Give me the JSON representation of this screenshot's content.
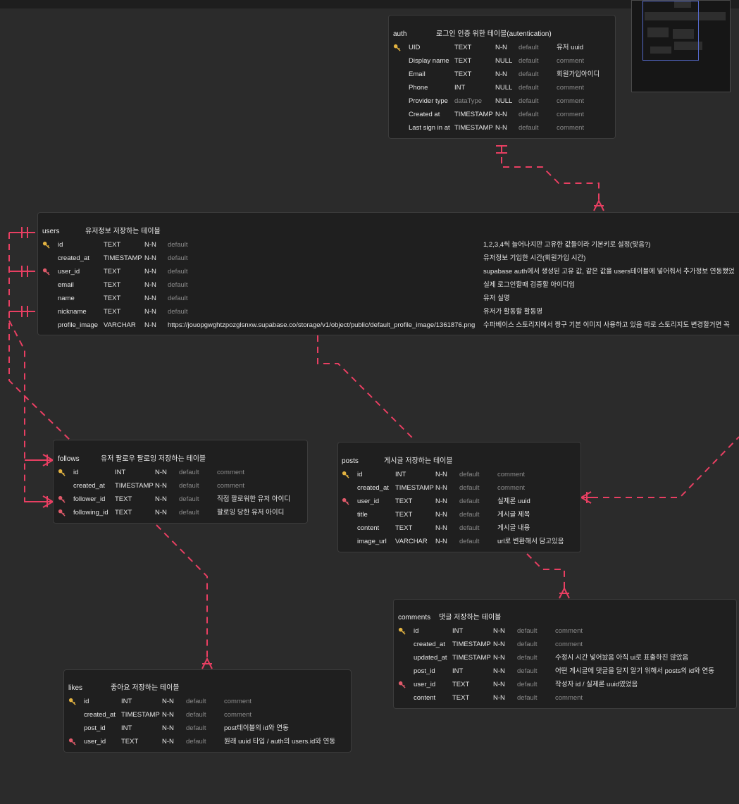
{
  "colors": {
    "relation": "#e83f62",
    "key_gold": "#e3b341",
    "key_red": "#e05a6a",
    "canvas": "#2b2b2b",
    "table_bg": "#1f1f1f"
  },
  "tables": {
    "auth": {
      "name": "auth",
      "description": "로그인 인증 위한 테이블(autentication)",
      "rows": [
        {
          "key": "primary",
          "name": "UID",
          "type": "TEXT",
          "null": "N-N",
          "default": "default",
          "comment": "유저 uuid"
        },
        {
          "key": "",
          "name": "Display name",
          "type": "TEXT",
          "null": "NULL",
          "default": "default",
          "comment": "comment"
        },
        {
          "key": "",
          "name": "Email",
          "type": "TEXT",
          "null": "N-N",
          "default": "default",
          "comment": "회원가입아이디"
        },
        {
          "key": "",
          "name": "Phone",
          "type": "INT",
          "null": "NULL",
          "default": "default",
          "comment": "comment"
        },
        {
          "key": "",
          "name": "Provider type",
          "type": "dataType",
          "null": "NULL",
          "default": "default",
          "comment": "comment"
        },
        {
          "key": "",
          "name": "Created at",
          "type": "TIMESTAMP",
          "null": "N-N",
          "default": "default",
          "comment": "comment"
        },
        {
          "key": "",
          "name": "Last sign in at",
          "type": "TIMESTAMP",
          "null": "N-N",
          "default": "default",
          "comment": "comment"
        }
      ]
    },
    "users": {
      "name": "users",
      "description": "유저정보 저장하는 테이블",
      "rows": [
        {
          "key": "primary",
          "name": "id",
          "type": "TEXT",
          "null": "N-N",
          "default": "default",
          "comment": "1,2,3,4씩 늘어나지만 고유한 값들이라 기본키로 설정(맞음?)"
        },
        {
          "key": "",
          "name": "created_at",
          "type": "TIMESTAMP",
          "null": "N-N",
          "default": "default",
          "comment": "유저정보 기입한 시간(회원가입 시간)"
        },
        {
          "key": "foreign",
          "name": "user_id",
          "type": "TEXT",
          "null": "N-N",
          "default": "default",
          "comment": "supabase auth에서 생성된 고유 값, 같은 값을 users테이블에 넣어줘서 추가정보 연동했었"
        },
        {
          "key": "",
          "name": "email",
          "type": "TEXT",
          "null": "N-N",
          "default": "default",
          "comment": "실제 로그인할때 검증할 아이디임"
        },
        {
          "key": "",
          "name": "name",
          "type": "TEXT",
          "null": "N-N",
          "default": "default",
          "comment": "유저 실명"
        },
        {
          "key": "",
          "name": "nickname",
          "type": "TEXT",
          "null": "N-N",
          "default": "default",
          "comment": "유저가 활동할 활동명"
        },
        {
          "key": "",
          "name": "profile_image",
          "type": "VARCHAR",
          "null": "N-N",
          "default": "https://jouopgwghtzpozglsnxw.supabase.co/storage/v1/object/public/default_profile_image/1361876.png",
          "comment": "수파베이스 스토리지에서 짱구 기본 이미지 사용하고 있음 따로 스토리지도 변경할거면 꼭"
        }
      ]
    },
    "follows": {
      "name": "follows",
      "description": "유저 팔로우 팔로잉 저장하는 테이블",
      "rows": [
        {
          "key": "primary",
          "name": "id",
          "type": "INT",
          "null": "N-N",
          "default": "default",
          "comment": "comment"
        },
        {
          "key": "",
          "name": "created_at",
          "type": "TIMESTAMP",
          "null": "N-N",
          "default": "default",
          "comment": "comment"
        },
        {
          "key": "foreign",
          "name": "follower_id",
          "type": "TEXT",
          "null": "N-N",
          "default": "default",
          "comment": "직접 팔로워한 유저 아이디"
        },
        {
          "key": "foreign",
          "name": "following_id",
          "type": "TEXT",
          "null": "N-N",
          "default": "default",
          "comment": "팔로잉 당한 유저 아이디"
        }
      ]
    },
    "posts": {
      "name": "posts",
      "description": "게시글 저장하는 테이블",
      "rows": [
        {
          "key": "primary",
          "name": "id",
          "type": "INT",
          "null": "N-N",
          "default": "default",
          "comment": "comment"
        },
        {
          "key": "",
          "name": "created_at",
          "type": "TIMESTAMP",
          "null": "N-N",
          "default": "default",
          "comment": "comment"
        },
        {
          "key": "foreign",
          "name": "user_id",
          "type": "TEXT",
          "null": "N-N",
          "default": "default",
          "comment": "실제론 uuid"
        },
        {
          "key": "",
          "name": "title",
          "type": "TEXT",
          "null": "N-N",
          "default": "default",
          "comment": "게시글 제목"
        },
        {
          "key": "",
          "name": "content",
          "type": "TEXT",
          "null": "N-N",
          "default": "default",
          "comment": "게시글 내용"
        },
        {
          "key": "",
          "name": "image_url",
          "type": "VARCHAR",
          "null": "N-N",
          "default": "default",
          "comment": "url로 변환해서 담고있음"
        }
      ]
    },
    "comments": {
      "name": "comments",
      "description": "댓글 저장하는 테이블",
      "rows": [
        {
          "key": "primary",
          "name": "id",
          "type": "INT",
          "null": "N-N",
          "default": "default",
          "comment": "comment"
        },
        {
          "key": "",
          "name": "created_at",
          "type": "TIMESTAMP",
          "null": "N-N",
          "default": "default",
          "comment": "comment"
        },
        {
          "key": "",
          "name": "updated_at",
          "type": "TIMESTAMP",
          "null": "N-N",
          "default": "default",
          "comment": "수정시 시간 넣어놨음 아직 ui로 표출하진 않았음"
        },
        {
          "key": "",
          "name": "post_id",
          "type": "INT",
          "null": "N-N",
          "default": "default",
          "comment": "어떤 게시글에 댓글을 달지 알기 위해서 posts의 id와 연동"
        },
        {
          "key": "foreign",
          "name": "user_id",
          "type": "TEXT",
          "null": "N-N",
          "default": "default",
          "comment": "작성자 id / 실제론 uuid였었음"
        },
        {
          "key": "",
          "name": "content",
          "type": "TEXT",
          "null": "N-N",
          "default": "default",
          "comment": "comment"
        }
      ]
    },
    "likes": {
      "name": "likes",
      "description": "좋아요 저장하는 테이블",
      "rows": [
        {
          "key": "primary",
          "name": "id",
          "type": "INT",
          "null": "N-N",
          "default": "default",
          "comment": "comment"
        },
        {
          "key": "",
          "name": "created_at",
          "type": "TIMESTAMP",
          "null": "N-N",
          "default": "default",
          "comment": "comment"
        },
        {
          "key": "",
          "name": "post_id",
          "type": "INT",
          "null": "N-N",
          "default": "default",
          "comment": "post테이블의 id와 연동"
        },
        {
          "key": "foreign",
          "name": "user_id",
          "type": "TEXT",
          "null": "N-N",
          "default": "default",
          "comment": "원래 uuid 타입 / auth의 users.id와 연동"
        }
      ]
    }
  }
}
